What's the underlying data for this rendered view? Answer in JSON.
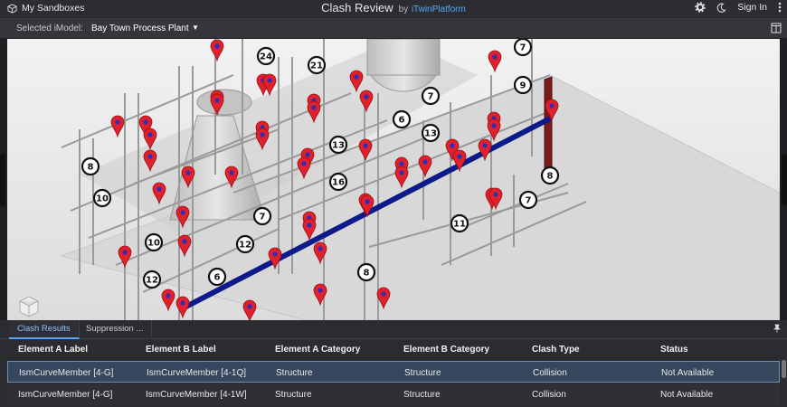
{
  "header": {
    "sandbox_label": "My Sandboxes",
    "title": "Clash Review",
    "by": "by",
    "brand": "iTwinPlatform",
    "sign_in": "Sign In"
  },
  "imodel": {
    "label": "Selected iModel:",
    "value": "Bay Town Process Plant"
  },
  "viewport": {
    "clash_counts": [
      "24",
      "21",
      "7",
      "9",
      "7",
      "6",
      "13",
      "8",
      "13",
      "16",
      "7",
      "8",
      "10",
      "7",
      "11",
      "10",
      "12",
      "12",
      "6",
      "8"
    ]
  },
  "tabs": [
    {
      "label": "Clash Results",
      "active": true
    },
    {
      "label": "Suppression ..."
    }
  ],
  "table": {
    "columns": [
      "Element A Label",
      "Element B Label",
      "Element A Category",
      "Element B Category",
      "Clash Type",
      "Status"
    ],
    "rows": [
      [
        "IsmCurveMember [4-G]",
        "IsmCurveMember [4-1Q]",
        "Structure",
        "Structure",
        "Collision",
        "Not Available"
      ],
      [
        "IsmCurveMember [4-G]",
        "IsmCurveMember [4-1W]",
        "Structure",
        "Structure",
        "Collision",
        "Not Available"
      ]
    ]
  },
  "colors": {
    "accent": "#5aa7ff",
    "marker": "#e0202a",
    "beam": "#0d1a8a"
  }
}
